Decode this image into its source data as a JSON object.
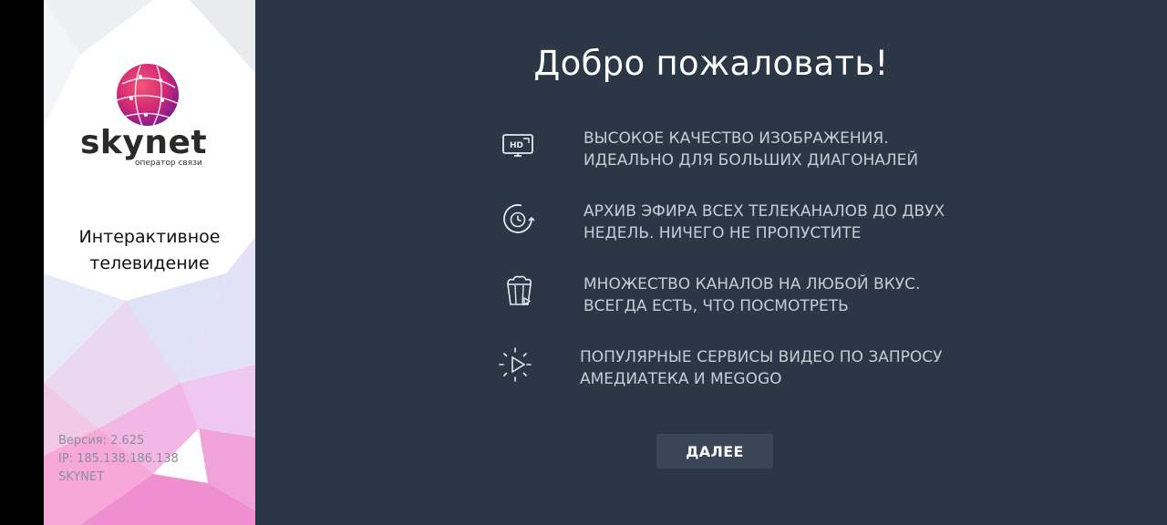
{
  "sidebar": {
    "brand": {
      "name": "skynet",
      "subtitle": "оператор связи"
    },
    "tagline": [
      "Интерактивное",
      "телевидение"
    ],
    "version": "Версия: 2.625",
    "ip": "IP: 185.138.186.138",
    "provider": "SKYNET"
  },
  "main": {
    "title": "Добро пожаловать!",
    "features": [
      {
        "icon": "hd-tv-icon",
        "lines": [
          "ВЫСОКОЕ КАЧЕСТВО ИЗОБРАЖЕНИЯ.",
          "ИДЕАЛЬНО ДЛЯ БОЛЬШИХ ДИАГОНАЛЕЙ"
        ]
      },
      {
        "icon": "archive-clock-icon",
        "lines": [
          "АРХИВ ЭФИРА ВСЕХ ТЕЛЕКАНАЛОВ ДО ДВУХ",
          "НЕДЕЛЬ. НИЧЕГО НЕ ПРОПУСТИТЕ"
        ]
      },
      {
        "icon": "popcorn-icon",
        "lines": [
          "МНОЖЕСТВО КАНАЛОВ НА ЛЮБОЙ ВКУС.",
          "ВСЕГДА ЕСТЬ, ЧТО ПОСМОТРЕТЬ"
        ]
      },
      {
        "icon": "play-video-icon",
        "lines": [
          "ПОПУЛЯРНЫЕ СЕРВИСЫ ВИДЕО ПО ЗАПРОСУ",
          "АМЕДИАТЕКА И MEGOGO"
        ]
      }
    ],
    "next_label": "ДАЛЕЕ"
  },
  "colors": {
    "main_background": "#2b3646",
    "button_background": "#3a4557",
    "text_light": "#c7ccd4",
    "brand_pink": "#e8345f",
    "brand_purple": "#8a1d8e"
  }
}
